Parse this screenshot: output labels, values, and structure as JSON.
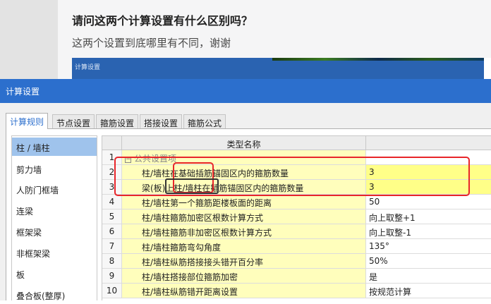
{
  "question": {
    "title": "请问这两个计算设置有什么区别吗？",
    "description": "这两个设置到底哪里有不同，谢谢"
  },
  "thumbnail": {
    "title": "计算设置"
  },
  "dialog": {
    "title": "计算设置",
    "tabs": [
      {
        "label": "计算规则",
        "active": true
      },
      {
        "label": "节点设置",
        "active": false
      },
      {
        "label": "箍筋设置",
        "active": false
      },
      {
        "label": "搭接设置",
        "active": false
      },
      {
        "label": "箍筋公式",
        "active": false
      }
    ],
    "sidebar": [
      {
        "label": "柱 / 墙柱",
        "selected": true
      },
      {
        "label": "剪力墙",
        "selected": false
      },
      {
        "label": "人防门框墙",
        "selected": false
      },
      {
        "label": "连梁",
        "selected": false
      },
      {
        "label": "框架梁",
        "selected": false
      },
      {
        "label": "非框架梁",
        "selected": false
      },
      {
        "label": "板",
        "selected": false
      },
      {
        "label": "叠合板(整厚)",
        "selected": false
      }
    ],
    "grid": {
      "header": {
        "num": "",
        "name": "类型名称",
        "value": ""
      },
      "group": {
        "num": "1",
        "toggle": "−",
        "name": "公共设置项"
      },
      "rows": [
        {
          "num": "2",
          "name": "柱/墙柱在基础插筋锚固区内的箍筋数量",
          "value": "3"
        },
        {
          "num": "3",
          "name": "梁(板)上柱/墙柱在插筋锚固区内的箍筋数量",
          "value": "3"
        },
        {
          "num": "4",
          "name": "柱/墙柱第一个箍筋距楼板面的距离",
          "value": "50"
        },
        {
          "num": "5",
          "name": "柱/墙柱箍筋加密区根数计算方式",
          "value": "向上取整+1"
        },
        {
          "num": "6",
          "name": "柱/墙柱箍筋非加密区根数计算方式",
          "value": "向上取整-1"
        },
        {
          "num": "7",
          "name": "柱/墙柱箍筋弯勾角度",
          "value": "135°"
        },
        {
          "num": "8",
          "name": "柱/墙柱纵筋搭接接头错开百分率",
          "value": "50%"
        },
        {
          "num": "9",
          "name": "柱/墙柱搭接部位箍筋加密",
          "value": "是"
        },
        {
          "num": "10",
          "name": "柱/墙柱纵筋错开距离设置",
          "value": "按规范计算"
        }
      ]
    }
  },
  "colors": {
    "titlebar": "#2c6fcd",
    "selection": "#9fc3ec",
    "highlight_row": "#fffebc",
    "highlight_value": "#ffff88",
    "annotation_red": "#e8252a"
  }
}
